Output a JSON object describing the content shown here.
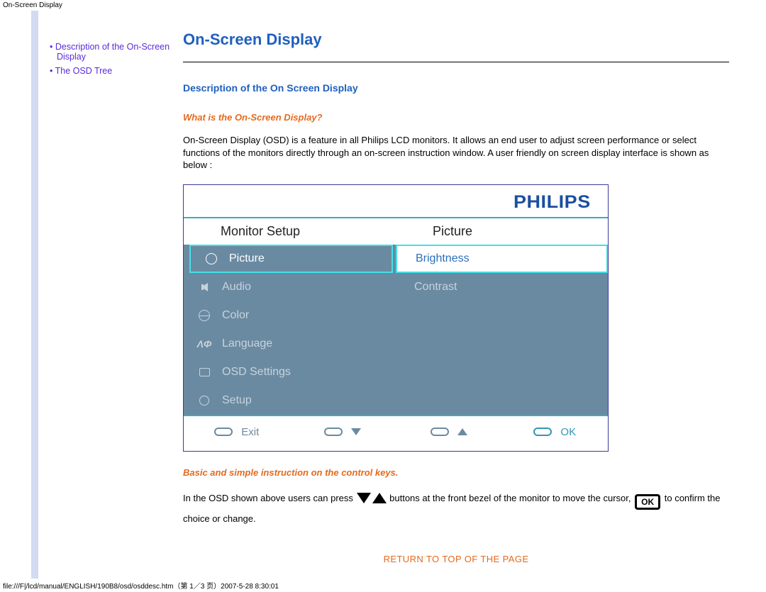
{
  "header_text": "On-Screen Display",
  "sidebar": {
    "links": [
      {
        "label": "Description of the On-Screen Display"
      },
      {
        "label": "The OSD Tree"
      }
    ]
  },
  "main": {
    "title": "On-Screen Display",
    "section_heading": "Description of the On Screen Display",
    "question": "What is the On-Screen Display?",
    "paragraph": "On-Screen Display (OSD) is a feature in all Philips LCD monitors. It allows an end user to adjust screen performance or select functions of the monitors directly through an on-screen instruction window. A user friendly on screen display interface is shown as below :",
    "osd": {
      "brand": "PHILIPS",
      "left_header": "Monitor Setup",
      "right_header": "Picture",
      "left_items": [
        {
          "label": "Picture",
          "selected": true,
          "icon": "sun-icon"
        },
        {
          "label": "Audio",
          "selected": false,
          "icon": "speaker-icon"
        },
        {
          "label": "Color",
          "selected": false,
          "icon": "globe-icon"
        },
        {
          "label": "Language",
          "selected": false,
          "icon": "language-icon"
        },
        {
          "label": "OSD Settings",
          "selected": false,
          "icon": "rect-icon"
        },
        {
          "label": "Setup",
          "selected": false,
          "icon": "gear-icon"
        }
      ],
      "right_items": [
        {
          "label": "Brightness",
          "selected": true
        },
        {
          "label": "Contrast",
          "selected": false
        }
      ],
      "footer": {
        "exit": "Exit",
        "ok": "OK"
      }
    },
    "instr_heading": "Basic and simple instruction on the control keys.",
    "instr_text_1": "In the OSD shown above users can press ",
    "instr_text_2": " buttons at the front bezel of the monitor to move the cursor, ",
    "instr_text_3": " to confirm the choice or change.",
    "ok_glyph": "OK",
    "return_link": "RETURN TO TOP OF THE PAGE"
  },
  "footer_path": "file:///F|/lcd/manual/ENGLISH/190B8/osd/osddesc.htm（第 1／3 页）2007-5-28 8:30:01"
}
